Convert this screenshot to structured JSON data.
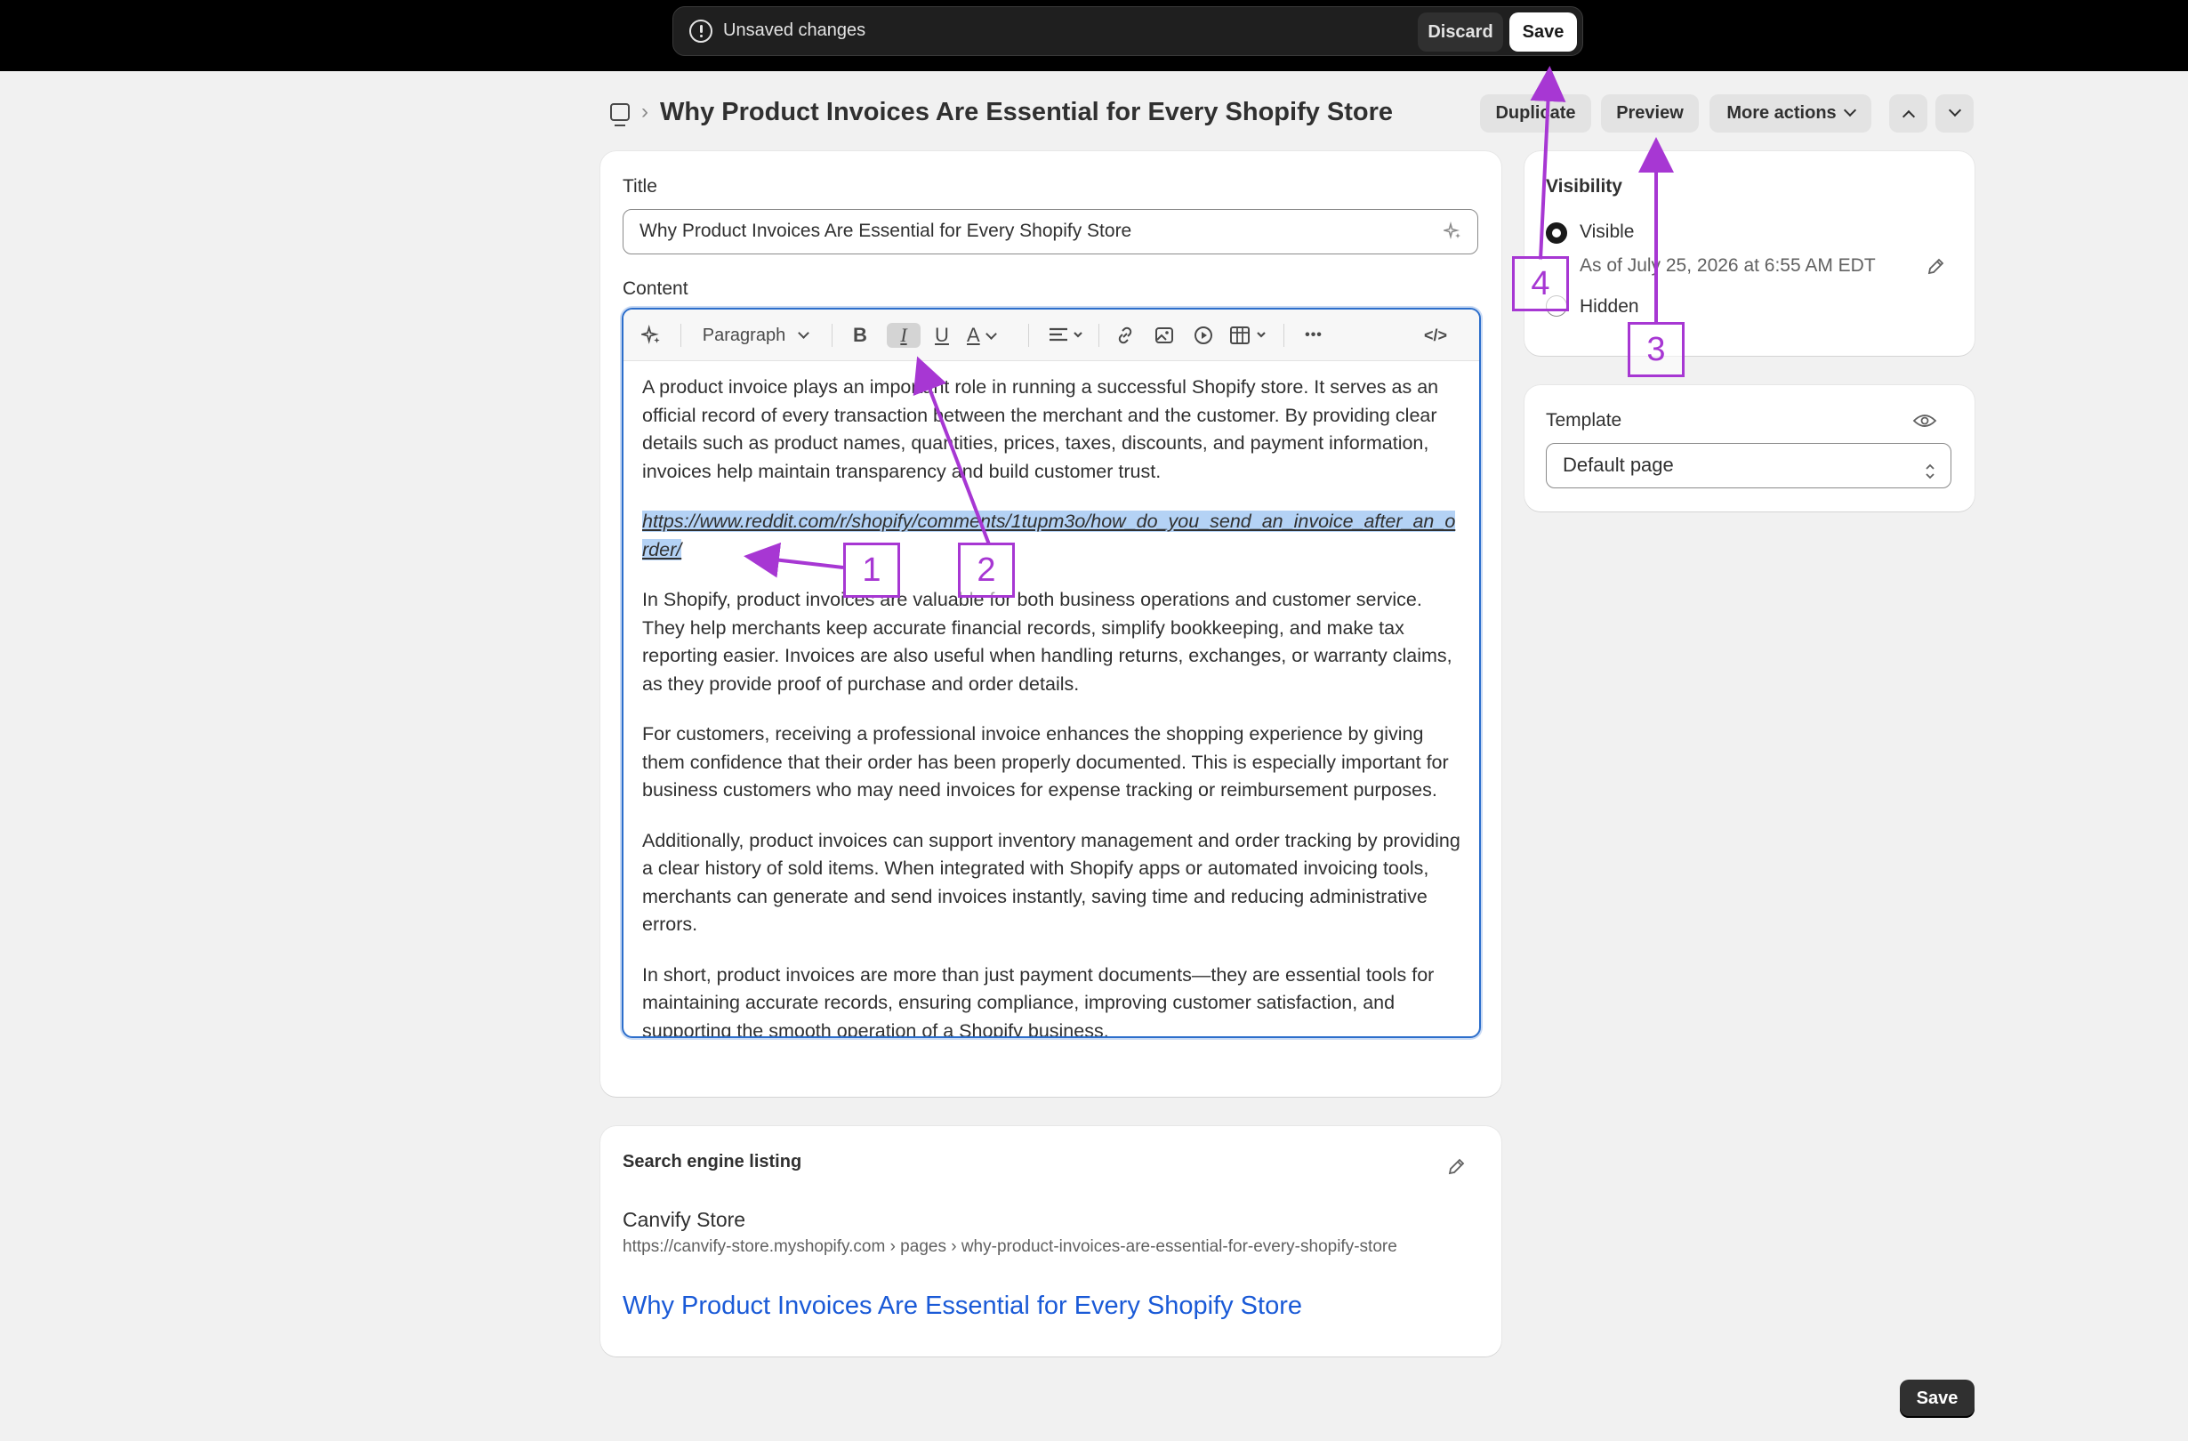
{
  "topbar": {
    "status_text": "Unsaved changes",
    "discard_label": "Discard",
    "save_label": "Save"
  },
  "header": {
    "breadcrumb_separator": "›",
    "title": "Why Product Invoices Are Essential for Every Shopify Store",
    "duplicate_label": "Duplicate",
    "preview_label": "Preview",
    "more_actions_label": "More actions"
  },
  "main": {
    "title_label": "Title",
    "title_value": "Why Product Invoices Are Essential for Every Shopify Store",
    "content_label": "Content",
    "toolbar": {
      "paragraph_label": "Paragraph",
      "bold_glyph": "B",
      "italic_glyph": "I",
      "underline_glyph": "U",
      "text_color_glyph": "A",
      "more_glyph": "•••",
      "code_glyph": "</>"
    },
    "paragraphs": [
      "A product invoice plays an important role in running a successful Shopify store. It serves as an official record of every transaction between the merchant and the customer. By providing clear details such as product names, quantities, prices, taxes, discounts, and payment information, invoices help maintain transparency and build customer trust.",
      "https://www.reddit.com/r/shopify/comments/1tupm3o/how_do_you_send_an_invoice_after_an_order/",
      "In Shopify, product invoices are valuable for both business operations and customer service. They help merchants keep accurate financial records, simplify bookkeeping, and make tax reporting easier. Invoices are also useful when handling returns, exchanges, or warranty claims, as they provide proof of purchase and order details.",
      "For customers, receiving a professional invoice enhances the shopping experience by giving them confidence that their order has been properly documented. This is especially important for business customers who may need invoices for expense tracking or reimbursement purposes.",
      "Additionally, product invoices can support inventory management and order tracking by providing a clear history of sold items. When integrated with Shopify apps or automated invoicing tools, merchants can generate and send invoices instantly, saving time and reducing administrative errors.",
      "In short, product invoices are more than just payment documents—they are essential tools for maintaining accurate records, ensuring compliance, improving customer satisfaction, and supporting the smooth operation of a Shopify business."
    ]
  },
  "visibility": {
    "heading": "Visibility",
    "visible_label": "Visible",
    "visible_date": "As of July 25, 2026 at 6:55 AM EDT",
    "hidden_label": "Hidden",
    "selected": "visible"
  },
  "template": {
    "heading": "Template",
    "selected": "Default page"
  },
  "seo": {
    "heading": "Search engine listing",
    "store_name": "Canvify Store",
    "url": "https://canvify-store.myshopify.com › pages › why-product-invoices-are-essential-for-every-shopify-store",
    "title": "Why Product Invoices Are Essential for Every Shopify Store",
    "title_color": "#1a5ad7"
  },
  "footer": {
    "save_label": "Save"
  },
  "annotations": {
    "color": "#a737d3",
    "labels": [
      "1",
      "2",
      "3",
      "4"
    ]
  }
}
